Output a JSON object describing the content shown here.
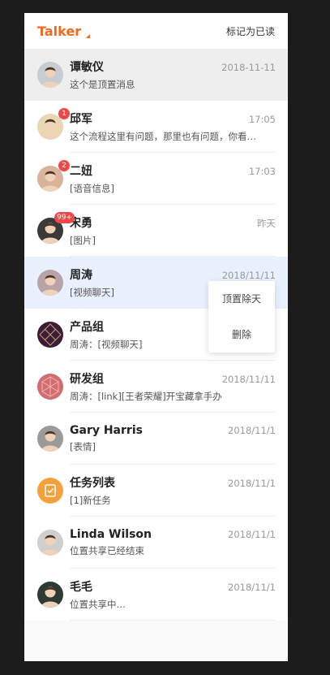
{
  "header": {
    "brand": "Talker",
    "mark_read": "标记为已读"
  },
  "conversations": [
    {
      "name": "谭敏仪",
      "time": "2018-11-11",
      "snippet": "这个是顶置消息",
      "badge": "",
      "avatar": "person",
      "pinned": true,
      "hover": false,
      "avatar_color": "#c7ccd3"
    },
    {
      "name": "邱军",
      "time": "17:05",
      "snippet": "这个流程这里有问题，那里也有问题，你看…",
      "badge": "1",
      "avatar": "person",
      "pinned": false,
      "hover": false,
      "avatar_color": "#e9d7b4"
    },
    {
      "name": "二妞",
      "time": "17:03",
      "snippet": "[语音信息]",
      "badge": "2",
      "avatar": "person",
      "pinned": false,
      "hover": false,
      "avatar_color": "#d9b49a"
    },
    {
      "name": "宋勇",
      "time": "昨天",
      "snippet": "[图片]",
      "badge": "99+",
      "avatar": "person",
      "pinned": false,
      "hover": false,
      "avatar_color": "#3a3a3a"
    },
    {
      "name": "周涛",
      "time": "2018/11/11",
      "snippet": "[视频聊天]",
      "badge": "",
      "avatar": "person",
      "pinned": false,
      "hover": true,
      "avatar_color": "#b8a3a8"
    },
    {
      "name": "产品组",
      "time": "",
      "snippet": "周涛：[视频聊天]",
      "badge": "",
      "avatar": "group-diamond",
      "pinned": false,
      "hover": false,
      "avatar_color": "#3b1d3a"
    },
    {
      "name": "研发组",
      "time": "2018/11/11",
      "snippet": "周涛：[link][王者荣耀]开宝藏拿手办",
      "badge": "",
      "avatar": "group-hex",
      "pinned": false,
      "hover": false,
      "avatar_color": "#d26c6e"
    },
    {
      "name": "Gary Harris",
      "time": "2018/11/1",
      "snippet": "[表情]",
      "badge": "",
      "avatar": "person",
      "pinned": false,
      "hover": false,
      "avatar_color": "#9a9a9a"
    },
    {
      "name": "任务列表",
      "time": "2018/11/1",
      "snippet": "[1]新任务",
      "badge": "",
      "avatar": "task-icon",
      "pinned": false,
      "hover": false,
      "avatar_color": "#f6a03c"
    },
    {
      "name": "Linda Wilson",
      "time": "2018/11/1",
      "snippet": "位置共享已经结束",
      "badge": "",
      "avatar": "person",
      "pinned": false,
      "hover": false,
      "avatar_color": "#cfcfcf"
    },
    {
      "name": "毛毛",
      "time": "2018/11/1",
      "snippet": "位置共享中…",
      "badge": "",
      "avatar": "person",
      "pinned": false,
      "hover": false,
      "avatar_color": "#2e3a36"
    }
  ],
  "context_menu": {
    "unpin": "顶置除天",
    "delete": "删除"
  }
}
